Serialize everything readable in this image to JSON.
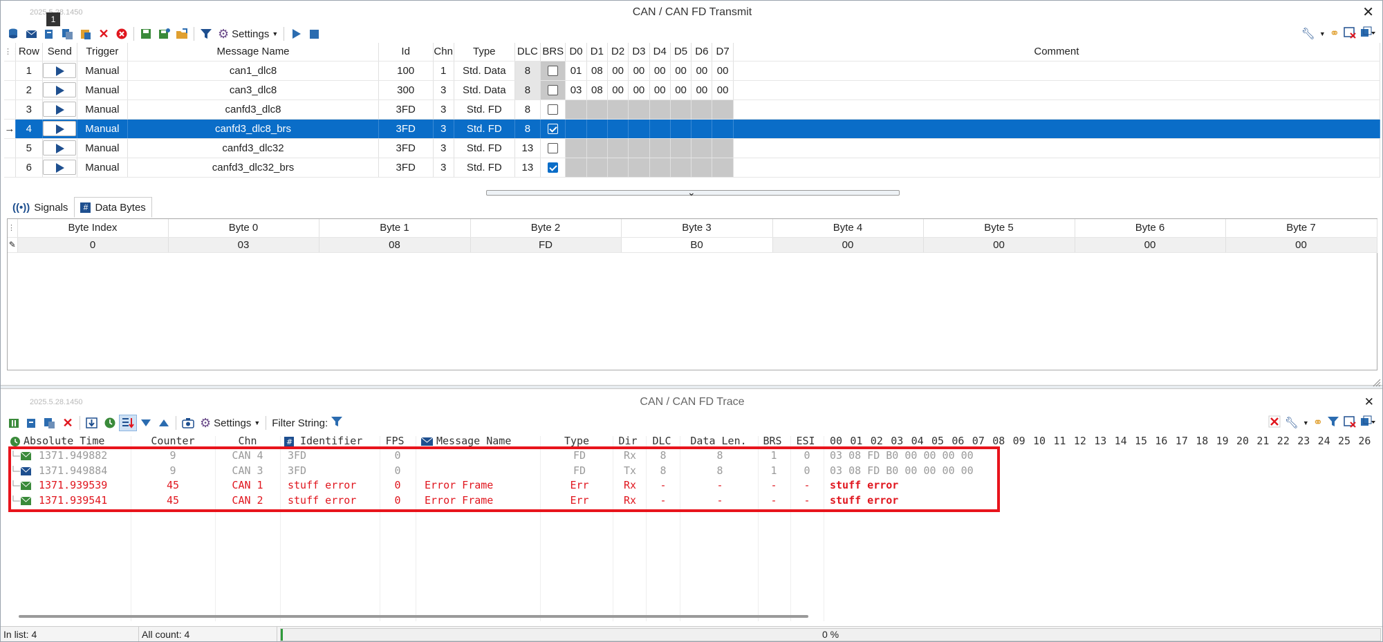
{
  "transmit": {
    "title": "CAN / CAN FD Transmit",
    "version": "2025.5.28.1450",
    "badge": "1",
    "settings_label": "Settings",
    "headers": [
      "Row",
      "Send",
      "Trigger",
      "Message Name",
      "Id",
      "Chn",
      "Type",
      "DLC",
      "BRS",
      "D0",
      "D1",
      "D2",
      "D3",
      "D4",
      "D5",
      "D6",
      "D7",
      "Comment"
    ],
    "rows": [
      {
        "row": "1",
        "trigger": "Manual",
        "name": "can1_dlc8",
        "id": "100",
        "chn": "1",
        "type": "Std. Data",
        "dlc": "8",
        "brs": false,
        "data": [
          "01",
          "08",
          "00",
          "00",
          "00",
          "00",
          "00",
          "00"
        ]
      },
      {
        "row": "2",
        "trigger": "Manual",
        "name": "can3_dlc8",
        "id": "300",
        "chn": "3",
        "type": "Std. Data",
        "dlc": "8",
        "brs": false,
        "data": [
          "03",
          "08",
          "00",
          "00",
          "00",
          "00",
          "00",
          "00"
        ]
      },
      {
        "row": "3",
        "trigger": "Manual",
        "name": "canfd3_dlc8",
        "id": "3FD",
        "chn": "3",
        "type": "Std. FD",
        "dlc": "8",
        "brs": false,
        "data": []
      },
      {
        "row": "4",
        "trigger": "Manual",
        "name": "canfd3_dlc8_brs",
        "id": "3FD",
        "chn": "3",
        "type": "Std. FD",
        "dlc": "8",
        "brs": true,
        "data": []
      },
      {
        "row": "5",
        "trigger": "Manual",
        "name": "canfd3_dlc32",
        "id": "3FD",
        "chn": "3",
        "type": "Std. FD",
        "dlc": "13",
        "brs": false,
        "data": []
      },
      {
        "row": "6",
        "trigger": "Manual",
        "name": "canfd3_dlc32_brs",
        "id": "3FD",
        "chn": "3",
        "type": "Std. FD",
        "dlc": "13",
        "brs": true,
        "data": []
      }
    ],
    "selected_row": "4"
  },
  "tabs": [
    {
      "label": "Signals",
      "icon": "signal-icon"
    },
    {
      "label": "Data Bytes",
      "icon": "hash-icon",
      "active": true
    }
  ],
  "bytes": {
    "headers": [
      "Byte Index",
      "Byte 0",
      "Byte 1",
      "Byte 2",
      "Byte 3",
      "Byte 4",
      "Byte 5",
      "Byte 6",
      "Byte 7"
    ],
    "values": [
      "0",
      "03",
      "08",
      "FD",
      "B0",
      "00",
      "00",
      "00",
      "00"
    ]
  },
  "trace": {
    "title": "CAN / CAN FD Trace",
    "version": "2025.5.28.1450",
    "settings_label": "Settings",
    "filter_label": "Filter String:",
    "headers": {
      "time": "Absolute Time",
      "counter": "Counter",
      "chn": "Chn",
      "identifier": "Identifier",
      "fps": "FPS",
      "name": "Message Name",
      "type": "Type",
      "dir": "Dir",
      "dlc": "DLC",
      "datalen": "Data Len.",
      "brs": "BRS",
      "esi": "ESI"
    },
    "byte_cols": [
      "00",
      "01",
      "02",
      "03",
      "04",
      "05",
      "06",
      "07",
      "08",
      "09",
      "10",
      "11",
      "12",
      "13",
      "14",
      "15",
      "16",
      "17",
      "18",
      "19",
      "20",
      "21",
      "22",
      "23",
      "24",
      "25",
      "26"
    ],
    "rows": [
      {
        "time": "1371.949882",
        "counter": "9",
        "chn": "CAN 4",
        "id": "3FD",
        "fps": "0",
        "name": "",
        "type": "FD",
        "dir": "Rx",
        "dlc": "8",
        "datalen": "8",
        "brs": "1",
        "esi": "0",
        "data": "03 08 FD B0 00 00 00 00",
        "kind": "grey"
      },
      {
        "time": "1371.949884",
        "counter": "9",
        "chn": "CAN 3",
        "id": "3FD",
        "fps": "0",
        "name": "",
        "type": "FD",
        "dir": "Tx",
        "dlc": "8",
        "datalen": "8",
        "brs": "1",
        "esi": "0",
        "data": "03 08 FD B0 00 00 00 00",
        "kind": "grey"
      },
      {
        "time": "1371.939539",
        "counter": "45",
        "chn": "CAN 1",
        "id": "stuff error",
        "fps": "0",
        "name": "Error Frame",
        "type": "Err",
        "dir": "Rx",
        "dlc": "-",
        "datalen": "-",
        "brs": "-",
        "esi": "-",
        "data": "stuff error",
        "kind": "err"
      },
      {
        "time": "1371.939541",
        "counter": "45",
        "chn": "CAN 2",
        "id": "stuff error",
        "fps": "0",
        "name": "Error Frame",
        "type": "Err",
        "dir": "Rx",
        "dlc": "-",
        "datalen": "-",
        "brs": "-",
        "esi": "-",
        "data": "stuff error",
        "kind": "err"
      }
    ]
  },
  "status": {
    "in_list": "In list: 4",
    "all_count": "All count: 4",
    "progress": "0 %",
    "progress_value": 0
  },
  "colors": {
    "selection": "#0a6dc8",
    "error": "#e0161e",
    "highlight_box": "#e8141c"
  }
}
